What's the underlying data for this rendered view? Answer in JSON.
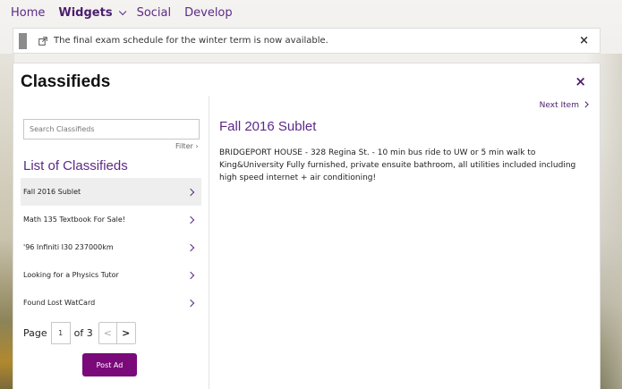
{
  "nav": {
    "items": [
      {
        "label": "Home"
      },
      {
        "label": "Widgets"
      },
      {
        "label": "Social"
      },
      {
        "label": "Develop"
      }
    ]
  },
  "banner": {
    "message": "The final exam schedule for the winter term is now available.",
    "close": "×"
  },
  "panel": {
    "title": "Classifieds",
    "close": "×"
  },
  "search": {
    "placeholder": "Search Classifieds"
  },
  "filter": {
    "label": "Filter ›"
  },
  "list": {
    "heading": "List of Classifieds",
    "items": [
      {
        "label": "Fall 2016 Sublet"
      },
      {
        "label": "Math 135 Textbook For Sale!"
      },
      {
        "label": "'96 Infiniti I30 237000km"
      },
      {
        "label": "Looking for a Physics Tutor"
      },
      {
        "label": "Found Lost WatCard"
      }
    ]
  },
  "pager": {
    "page_label": "Page",
    "current": "1",
    "of_label": "of 3",
    "prev": "<",
    "next": ">"
  },
  "post": {
    "label": "Post Ad"
  },
  "detail": {
    "next_label": "Next Item",
    "title": "Fall 2016 Sublet",
    "body": "BRIDGEPORT HOUSE - 328 Regina St. - 10 min bus ride to UW or 5 min walk to King&University Fully furnished, private ensuite bathroom, all utilities included including high speed internet + air conditioning!"
  },
  "colors": {
    "accent": "#5b2a86",
    "button": "#7a0a7a"
  }
}
